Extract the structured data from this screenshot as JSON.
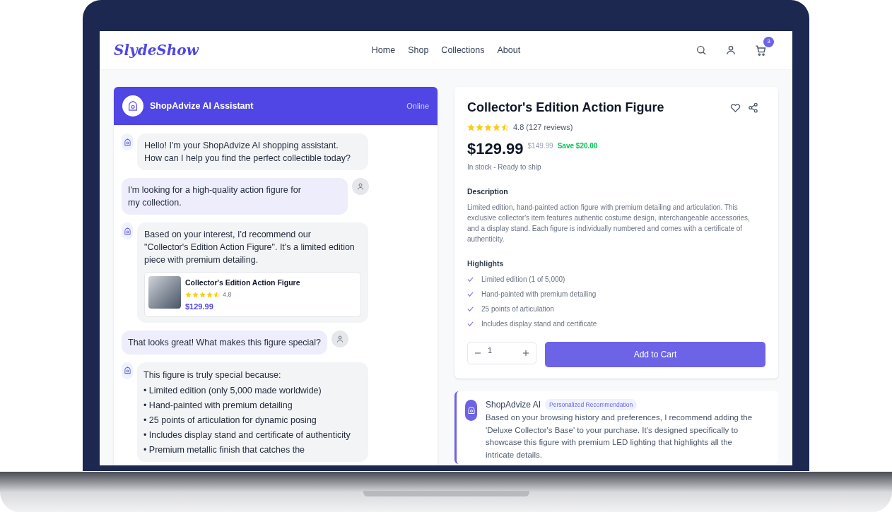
{
  "nav": {
    "logo": "SlydeShow",
    "links": [
      {
        "label": "Home"
      },
      {
        "label": "Shop"
      },
      {
        "label": "Collections"
      },
      {
        "label": "About"
      }
    ],
    "cart_count": "3"
  },
  "chat": {
    "title": "ShopAdvize AI Assistant",
    "status": "Online",
    "messages": [
      {
        "kind": "assistant",
        "lines": [
          "Hello! I'm your ShopAdvize AI shopping assistant.",
          "How can I help you find the perfect collectible today?"
        ]
      },
      {
        "kind": "user",
        "lines": [
          "I'm looking for a high-quality action figure for",
          "my collection."
        ]
      },
      {
        "kind": "assistant",
        "lines": [
          "Based on your interest, I'd recommend our",
          "\"Collector's Edition Action Figure\". It's a limited edition",
          "piece with premium detailing."
        ],
        "product": {
          "name": "Collector's Edition Action Figure",
          "stars": 4.5,
          "rating": "4.8",
          "price": "$129.99"
        }
      },
      {
        "kind": "user",
        "lines": [
          "That looks great! What makes this figure special?"
        ]
      },
      {
        "kind": "assistant",
        "lines": [
          "This figure is truly special because:"
        ],
        "bullets": [
          "• Limited edition (only 5,000 made worldwide)",
          "• Hand-painted with premium detailing",
          "• 25 points of articulation for dynamic posing",
          "• Includes display stand and certificate of authenticity",
          "• Premium metallic finish that catches the"
        ]
      }
    ]
  },
  "product": {
    "title": "Collector's Edition Action Figure",
    "stars": 4.5,
    "rating": "4.8 (127 reviews)",
    "price": "$129.99",
    "old_price": "$149.99",
    "savings": "Save $20.00",
    "stock": "In stock - Ready to ship",
    "description_heading": "Description",
    "description": "Limited edition, hand-painted action figure with premium detailing and articulation. This exclusive collector's item features authentic costume design, interchangeable accessories, and a display stand. Each figure is individually numbered and comes with a certificate of authenticity.",
    "highlights_heading": "Highlights",
    "highlights": [
      "Limited edition (1 of 5,000)",
      "Hand-painted with premium detailing",
      "25 points of articulation",
      "Includes display stand and certificate"
    ],
    "quantity": "1",
    "add_button": "Add to Cart"
  },
  "recommendation": {
    "sender": "ShopAdvize AI",
    "tag": "Personalized Recommendation",
    "text": "Based on your browsing history and preferences, I recommend adding the 'Deluxe Collector's Base' to your purchase. It's designed specifically to showcase this figure with premium LED lighting that highlights all the intricate details."
  }
}
